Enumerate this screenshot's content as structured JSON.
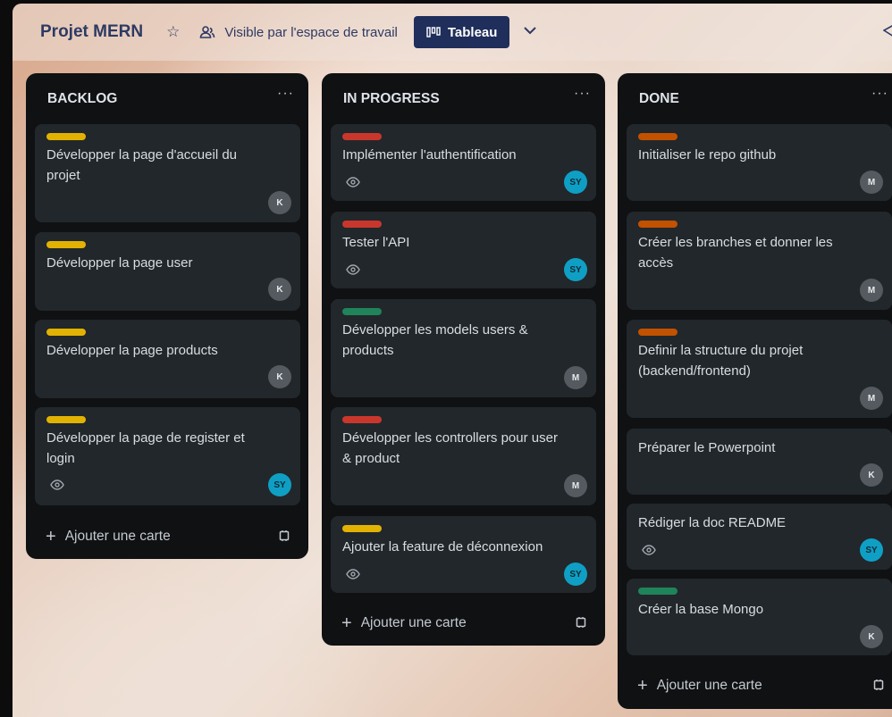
{
  "header": {
    "board_title": "Projet MERN",
    "visibility": "Visible par l'espace de travail",
    "view_label": "Tableau"
  },
  "colors": {
    "yellow": "#e2b203",
    "red": "#c9372c",
    "green": "#1f845a",
    "orange": "#c25100",
    "avatar_gray": "#555a60",
    "avatar_teal": "#0f9fc4"
  },
  "lists": [
    {
      "title": "BACKLOG",
      "menu": "···",
      "add_card": "Ajouter une carte",
      "cards": [
        {
          "label": "yellow",
          "title": "Développer la page d'accueil du projet",
          "watch": false,
          "avatar": "K"
        },
        {
          "label": "yellow",
          "title": "Développer la page user",
          "watch": false,
          "avatar": "K"
        },
        {
          "label": "yellow",
          "title": "Développer la page products",
          "watch": false,
          "avatar": "K"
        },
        {
          "label": "yellow",
          "title": "Développer la page de register et login",
          "watch": true,
          "avatar": "SY"
        }
      ]
    },
    {
      "title": "IN PROGRESS",
      "menu": "···",
      "add_card": "Ajouter une carte",
      "cards": [
        {
          "label": "red",
          "title": "Implémenter l'authentification",
          "watch": true,
          "avatar": "SY"
        },
        {
          "label": "red",
          "title": "Tester l'API",
          "watch": true,
          "avatar": "SY"
        },
        {
          "label": "green",
          "title": "Développer les models users & products",
          "watch": false,
          "avatar": "M"
        },
        {
          "label": "red",
          "title": "Développer les controllers pour user & product",
          "watch": false,
          "avatar": "M"
        },
        {
          "label": "yellow",
          "title": "Ajouter la feature de déconnexion",
          "watch": true,
          "avatar": "SY"
        }
      ]
    },
    {
      "title": "DONE",
      "menu": "···",
      "add_card": "Ajouter une carte",
      "cards": [
        {
          "label": "orange",
          "title": "Initialiser le repo github",
          "watch": false,
          "avatar": "M"
        },
        {
          "label": "orange",
          "title": "Créer les branches et donner les accès",
          "watch": false,
          "avatar": "M"
        },
        {
          "label": "orange",
          "title": "Definir la structure du projet (backend/frontend)",
          "watch": false,
          "avatar": "M"
        },
        {
          "label": "",
          "title": "Préparer le Powerpoint",
          "watch": false,
          "avatar": "K"
        },
        {
          "label": "",
          "title": "Rédiger la doc README",
          "watch": true,
          "avatar": "SY"
        },
        {
          "label": "green",
          "title": "Créer la base Mongo",
          "watch": false,
          "avatar": "K"
        }
      ]
    }
  ]
}
